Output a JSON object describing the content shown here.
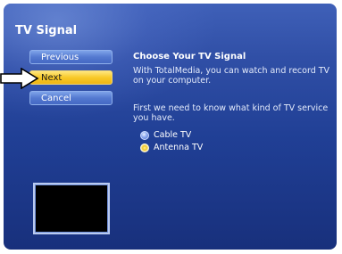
{
  "window": {
    "title": "TV Signal"
  },
  "nav": {
    "previous_label": "Previous",
    "next_label": "Next",
    "cancel_label": "Cancel"
  },
  "content": {
    "heading": "Choose Your TV Signal",
    "intro": "With TotalMedia, you can watch and record TV on your computer.",
    "question": "First we need to know what kind of TV service you have.",
    "options": [
      {
        "label": "Cable TV",
        "selected": false
      },
      {
        "label": "Antenna TV",
        "selected": true
      }
    ]
  },
  "colors": {
    "accent_yellow": "#f8c928",
    "button_blue": "#5479d0",
    "background_blue": "#203f95"
  },
  "icons": {
    "pointer": "arrow-pointer-icon"
  }
}
